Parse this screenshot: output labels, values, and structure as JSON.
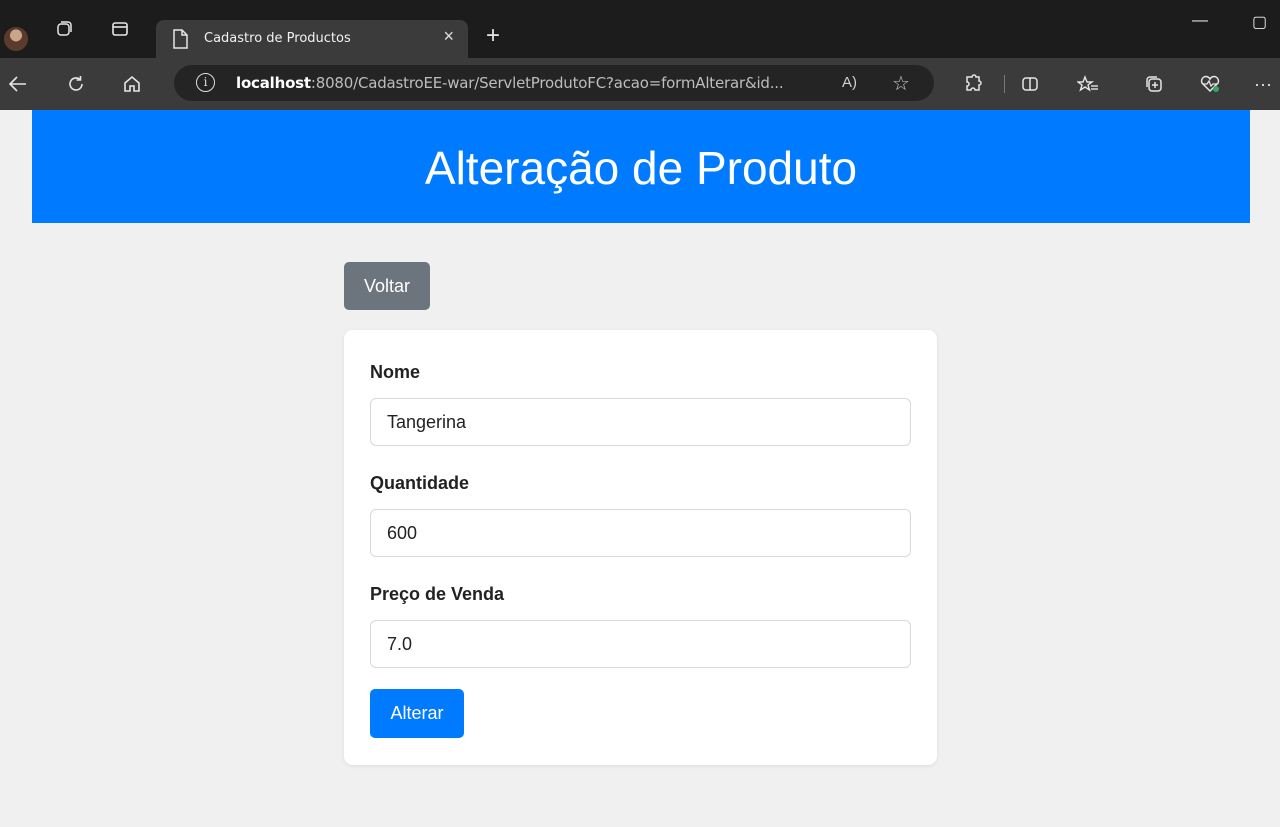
{
  "browser": {
    "tab_title": "Cadastro de Productos",
    "tab_close": "×",
    "new_tab": "+",
    "url_host": "localhost",
    "url_rest": ":8080/CadastroEE-war/ServletProdutoFC?acao=formAlterar&id...",
    "read_aloud": "A)",
    "minimize": "—",
    "maximize": "▢",
    "more": "···",
    "icons": [
      "avatar",
      "workspaces-icon",
      "tab-actions-icon",
      "page-icon",
      "close-icon",
      "new-tab-icon",
      "back-icon",
      "refresh-icon",
      "home-icon",
      "info-icon",
      "read-aloud-icon",
      "favorite-star-icon",
      "extensions-icon",
      "split-screen-icon",
      "favorites-icon",
      "collections-icon",
      "browser-essentials-icon",
      "more-icon"
    ]
  },
  "header": {
    "title": "Alteração de Produto",
    "color": "#007bff"
  },
  "back_button": "Voltar",
  "form": {
    "nome_label": "Nome",
    "nome_value": "Tangerina",
    "quantidade_label": "Quantidade",
    "quantidade_value": "600",
    "preco_label": "Preço de Venda",
    "preco_value": "7.0",
    "submit_label": "Alterar"
  },
  "colors": {
    "primary": "#007bff",
    "secondary": "#6c757d",
    "background": "#f0f0f0"
  }
}
